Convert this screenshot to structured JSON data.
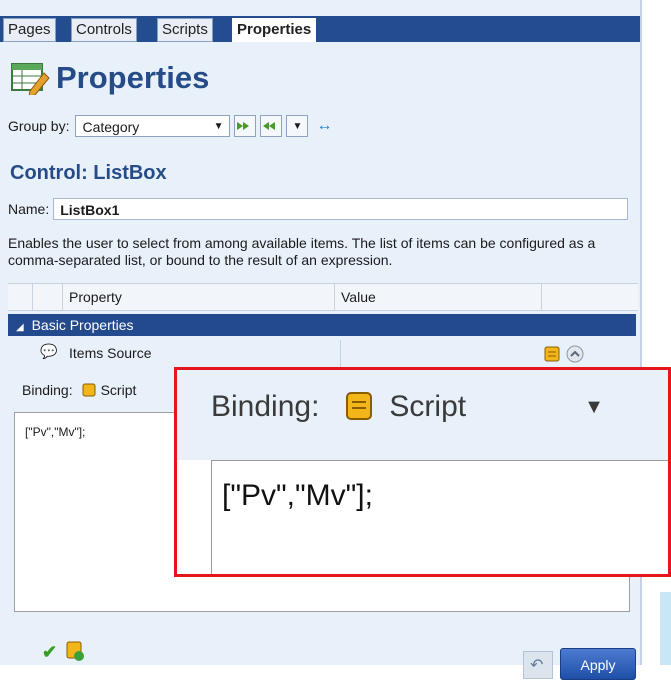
{
  "tabs": [
    {
      "label": "Pages",
      "active": false
    },
    {
      "label": "Controls",
      "active": false
    },
    {
      "label": "Scripts",
      "active": false
    },
    {
      "label": "Properties",
      "active": true
    }
  ],
  "header": {
    "title": "Properties",
    "icon": "properties-table-icon"
  },
  "toolbar": {
    "group_by_label": "Group by:",
    "group_by_value": "Category",
    "expand_all_icon": "expand-all-icon",
    "collapse_all_icon": "collapse-all-icon",
    "options_icon": "dropdown-icon",
    "resize_icon": "resize-arrows-icon"
  },
  "control": {
    "title": "Control: ListBox",
    "name_label": "Name:",
    "name_value": "ListBox1",
    "description": "Enables the user to select from among available items. The list of items can be configured as a comma-separated list, or bound to the result of an expression."
  },
  "grid": {
    "headers": [
      "Property",
      "Value"
    ],
    "category": "Basic Properties",
    "rows": [
      {
        "label": "Items Source"
      }
    ]
  },
  "binding": {
    "label": "Binding:",
    "type": "Script",
    "code": "[\"Pv\",\"Mv\"];"
  },
  "footer": {
    "apply_label": "Apply"
  },
  "colors": {
    "accent": "#244d8f",
    "panel": "#e8f0fa",
    "highlight_border": "#e5151b",
    "title": "#264c88"
  }
}
